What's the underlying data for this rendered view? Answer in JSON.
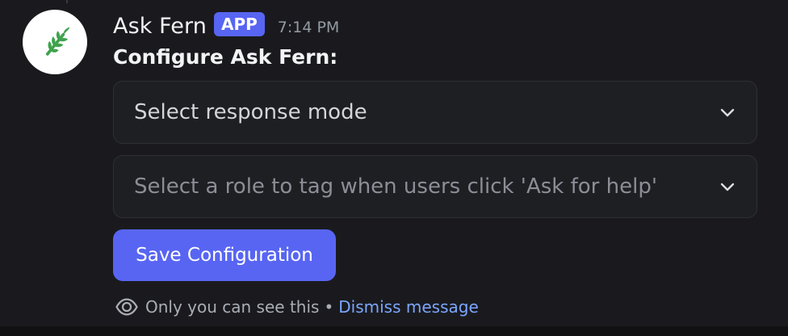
{
  "message": {
    "author": "Ask Fern",
    "badge": "APP",
    "timestamp": "7:14 PM",
    "title": "Configure Ask Fern:"
  },
  "selects": [
    {
      "value": "Select response mode",
      "is_placeholder": false
    },
    {
      "placeholder": "Select a role to tag when users click 'Ask for help'",
      "is_placeholder": true
    }
  ],
  "save_button": {
    "label": "Save Configuration"
  },
  "ephemeral": {
    "note": "Only you can see this",
    "separator": "•",
    "dismiss": "Dismiss message"
  },
  "icons": {
    "avatar": "leaf-sprig-icon",
    "chevron": "chevron-down-icon",
    "eye": "eye-icon"
  },
  "colors": {
    "background": "#1a1a1e",
    "accent": "#5865f2",
    "link": "#7ba7ff",
    "leaf": "#3fa34d"
  }
}
